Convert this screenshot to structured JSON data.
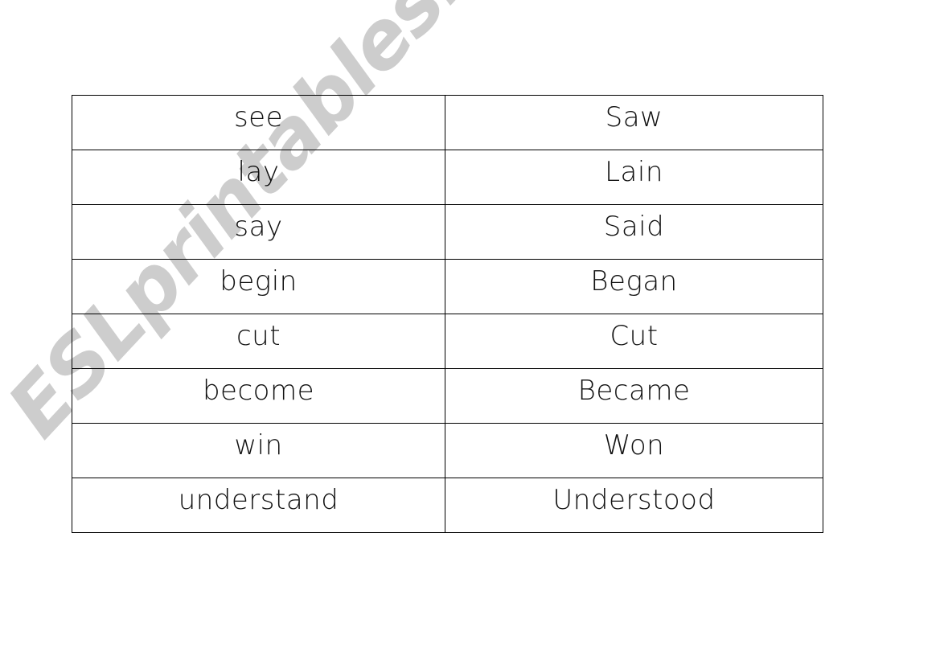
{
  "worksheet": {
    "rows": [
      {
        "base": "see",
        "past": "Saw"
      },
      {
        "base": "lay",
        "past": "Lain"
      },
      {
        "base": "say",
        "past": "Said"
      },
      {
        "base": "begin",
        "past": "Began"
      },
      {
        "base": "cut",
        "past": "Cut"
      },
      {
        "base": "become",
        "past": "Became"
      },
      {
        "base": "win",
        "past": "Won"
      },
      {
        "base": "understand",
        "past": "Understood"
      }
    ]
  },
  "watermark": {
    "text": "ESLprintables.com",
    "color": "#c4c4c4"
  }
}
